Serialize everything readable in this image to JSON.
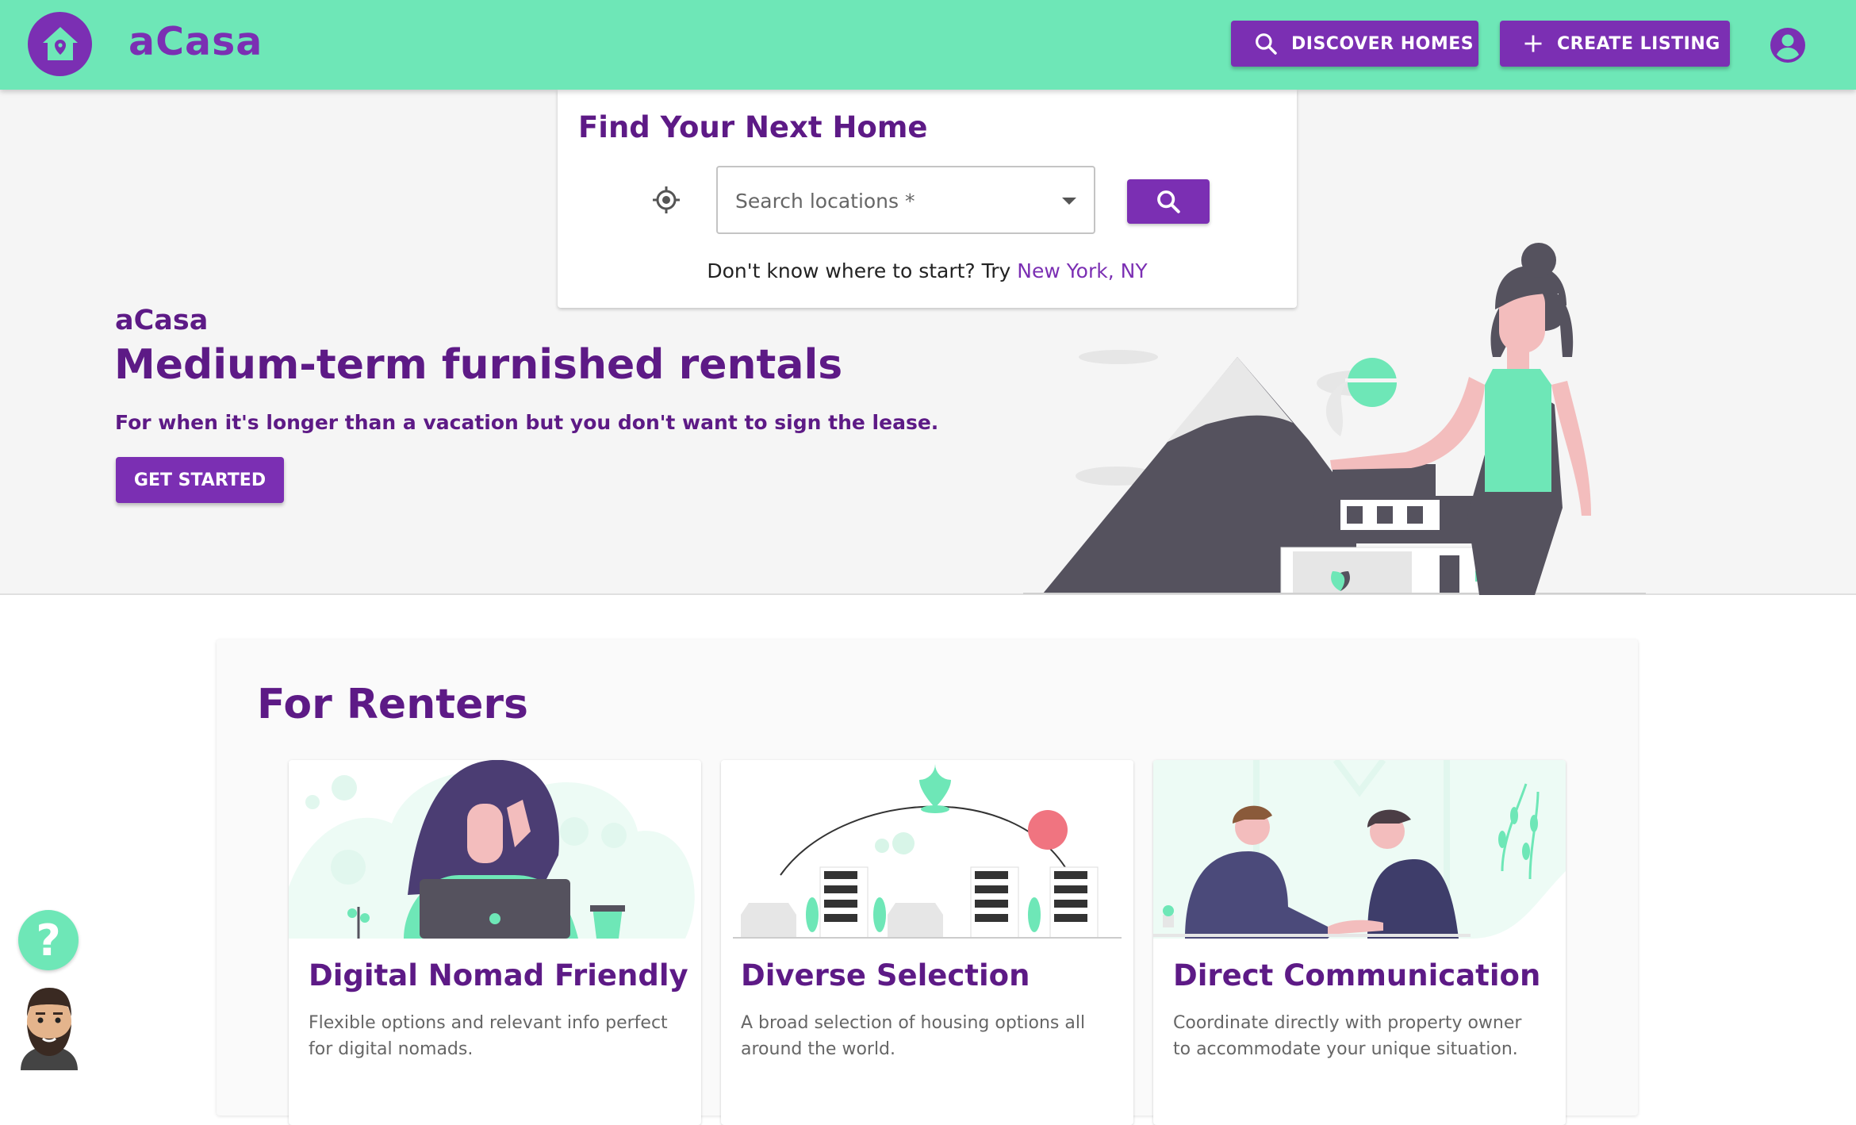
{
  "header": {
    "brand": "aCasa",
    "discover_label": "DISCOVER HOMES",
    "create_label": "CREATE LISTING"
  },
  "search": {
    "title": "Find Your Next Home",
    "placeholder": "Search locations *",
    "hint_prefix": "Don't know where to start? Try ",
    "hint_city": "New York, NY"
  },
  "hero": {
    "brand": "aCasa",
    "title": "Medium-term furnished rentals",
    "subtitle": "For when it's longer than a vacation but you don't want to sign the lease.",
    "cta_label": "GET STARTED"
  },
  "renters": {
    "title": "For Renters",
    "cards": [
      {
        "title": "Digital Nomad Friendly",
        "desc": "Flexible options and relevant info perfect for digital nomads."
      },
      {
        "title": "Diverse Selection",
        "desc": "A broad selection of housing options all around the world."
      },
      {
        "title": "Direct Communication",
        "desc": "Coordinate directly with property owner to accommodate your unique situation."
      }
    ]
  },
  "help": {
    "symbol": "?"
  },
  "colors": {
    "accent": "#7b2fb3",
    "brand_dark": "#5d1a86",
    "mint": "#6ee7b7"
  }
}
